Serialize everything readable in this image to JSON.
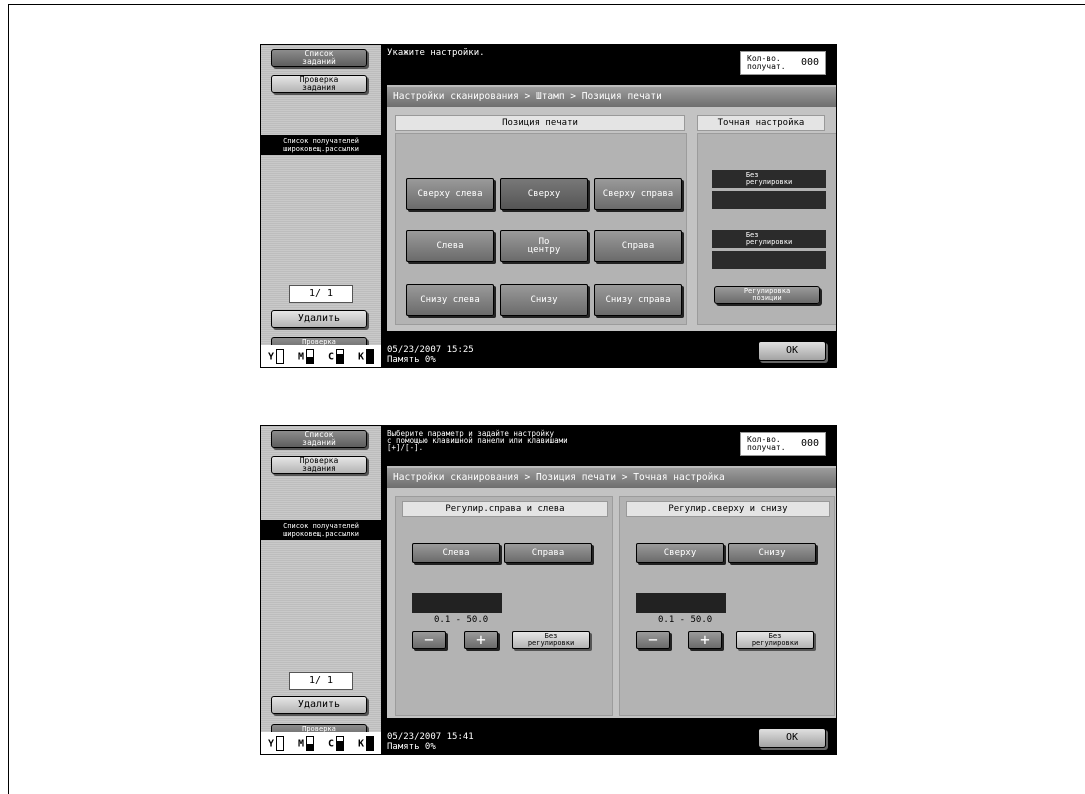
{
  "screen1": {
    "sidebar": {
      "job_list": "Список\nзаданий",
      "job_check": "Проверка\nзадания",
      "recipient_list": "Список получателей\nшироковещ.рассылки",
      "page_counter": "1/  1",
      "delete": "Удалить",
      "check_settings": "Проверка\nнастр.задан.",
      "cmyk": [
        "Y",
        "M",
        "C",
        "K"
      ]
    },
    "message": "Укажите настройки.",
    "qty_label": "Кол-во.\nполучат.",
    "qty_value": "000",
    "breadcrumb": "Настройки сканирования > Штамп > Позиция печати",
    "left_header": "Позиция печати",
    "right_header": "Точная настройка",
    "positions": [
      [
        "Сверху слева",
        "Сверху",
        "Сверху справа"
      ],
      [
        "Слева",
        "По\nцентру",
        "Справа"
      ],
      [
        "Снизу слева",
        "Снизу",
        "Снизу справа"
      ]
    ],
    "fine_1": "Без\nрегулировки",
    "fine_2": "Без\nрегулировки",
    "adjust_position": "Регулировка\nпозиции",
    "timestamp": "05/23/2007   15:25",
    "memory": "Память       0%",
    "ok": "OK"
  },
  "screen2": {
    "sidebar": {
      "job_list": "Список\nзаданий",
      "job_check": "Проверка\nзадания",
      "recipient_list": "Список получателей\nшироковещ.рассылки",
      "page_counter": "1/  1",
      "delete": "Удалить",
      "check_settings": "Проверка\nнастр.задан.",
      "cmyk": [
        "Y",
        "M",
        "C",
        "K"
      ]
    },
    "message": "Выберите параметр и задайте настройку\nс помощью клавишной панели или клавишами\n[+]/[-].",
    "qty_label": "Кол-во.\nполучат.",
    "qty_value": "000",
    "breadcrumb": "Настройки сканирования > Позиция печати > Точная настройка",
    "lr_header": "Регулир.справа и слева",
    "tb_header": "Регулир.сверху и снизу",
    "left": "Слева",
    "right": "Справа",
    "top": "Сверху",
    "bottom": "Снизу",
    "range": "0.1  -   50.0",
    "minus": "−",
    "plus": "+",
    "no_adjust": "Без\nрегулировки",
    "timestamp": "05/23/2007   15:41",
    "memory": "Память       0%",
    "ok": "OK"
  }
}
